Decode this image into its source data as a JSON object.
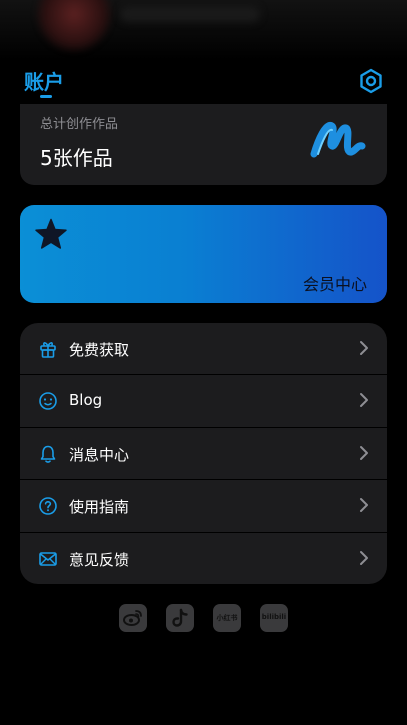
{
  "header": {
    "title": "账户"
  },
  "works": {
    "label": "总计创作作品",
    "count": "5张作品"
  },
  "vip": {
    "label": "会员中心"
  },
  "menu": [
    {
      "label": "免费获取",
      "icon": "gift-icon"
    },
    {
      "label": "Blog",
      "icon": "smile-face-icon"
    },
    {
      "label": "消息中心",
      "icon": "bell-icon"
    },
    {
      "label": "使用指南",
      "icon": "help-circle-icon"
    },
    {
      "label": "意见反馈",
      "icon": "mail-icon"
    }
  ],
  "social": [
    {
      "name": "weibo-icon"
    },
    {
      "name": "tiktok-icon"
    },
    {
      "name": "xiaohongshu-icon",
      "text": "小红书"
    },
    {
      "name": "bilibili-icon",
      "text": "bilibili"
    }
  ],
  "colors": {
    "accent": "#1a9de8",
    "card": "#1c1c1e",
    "background": "#000000"
  }
}
